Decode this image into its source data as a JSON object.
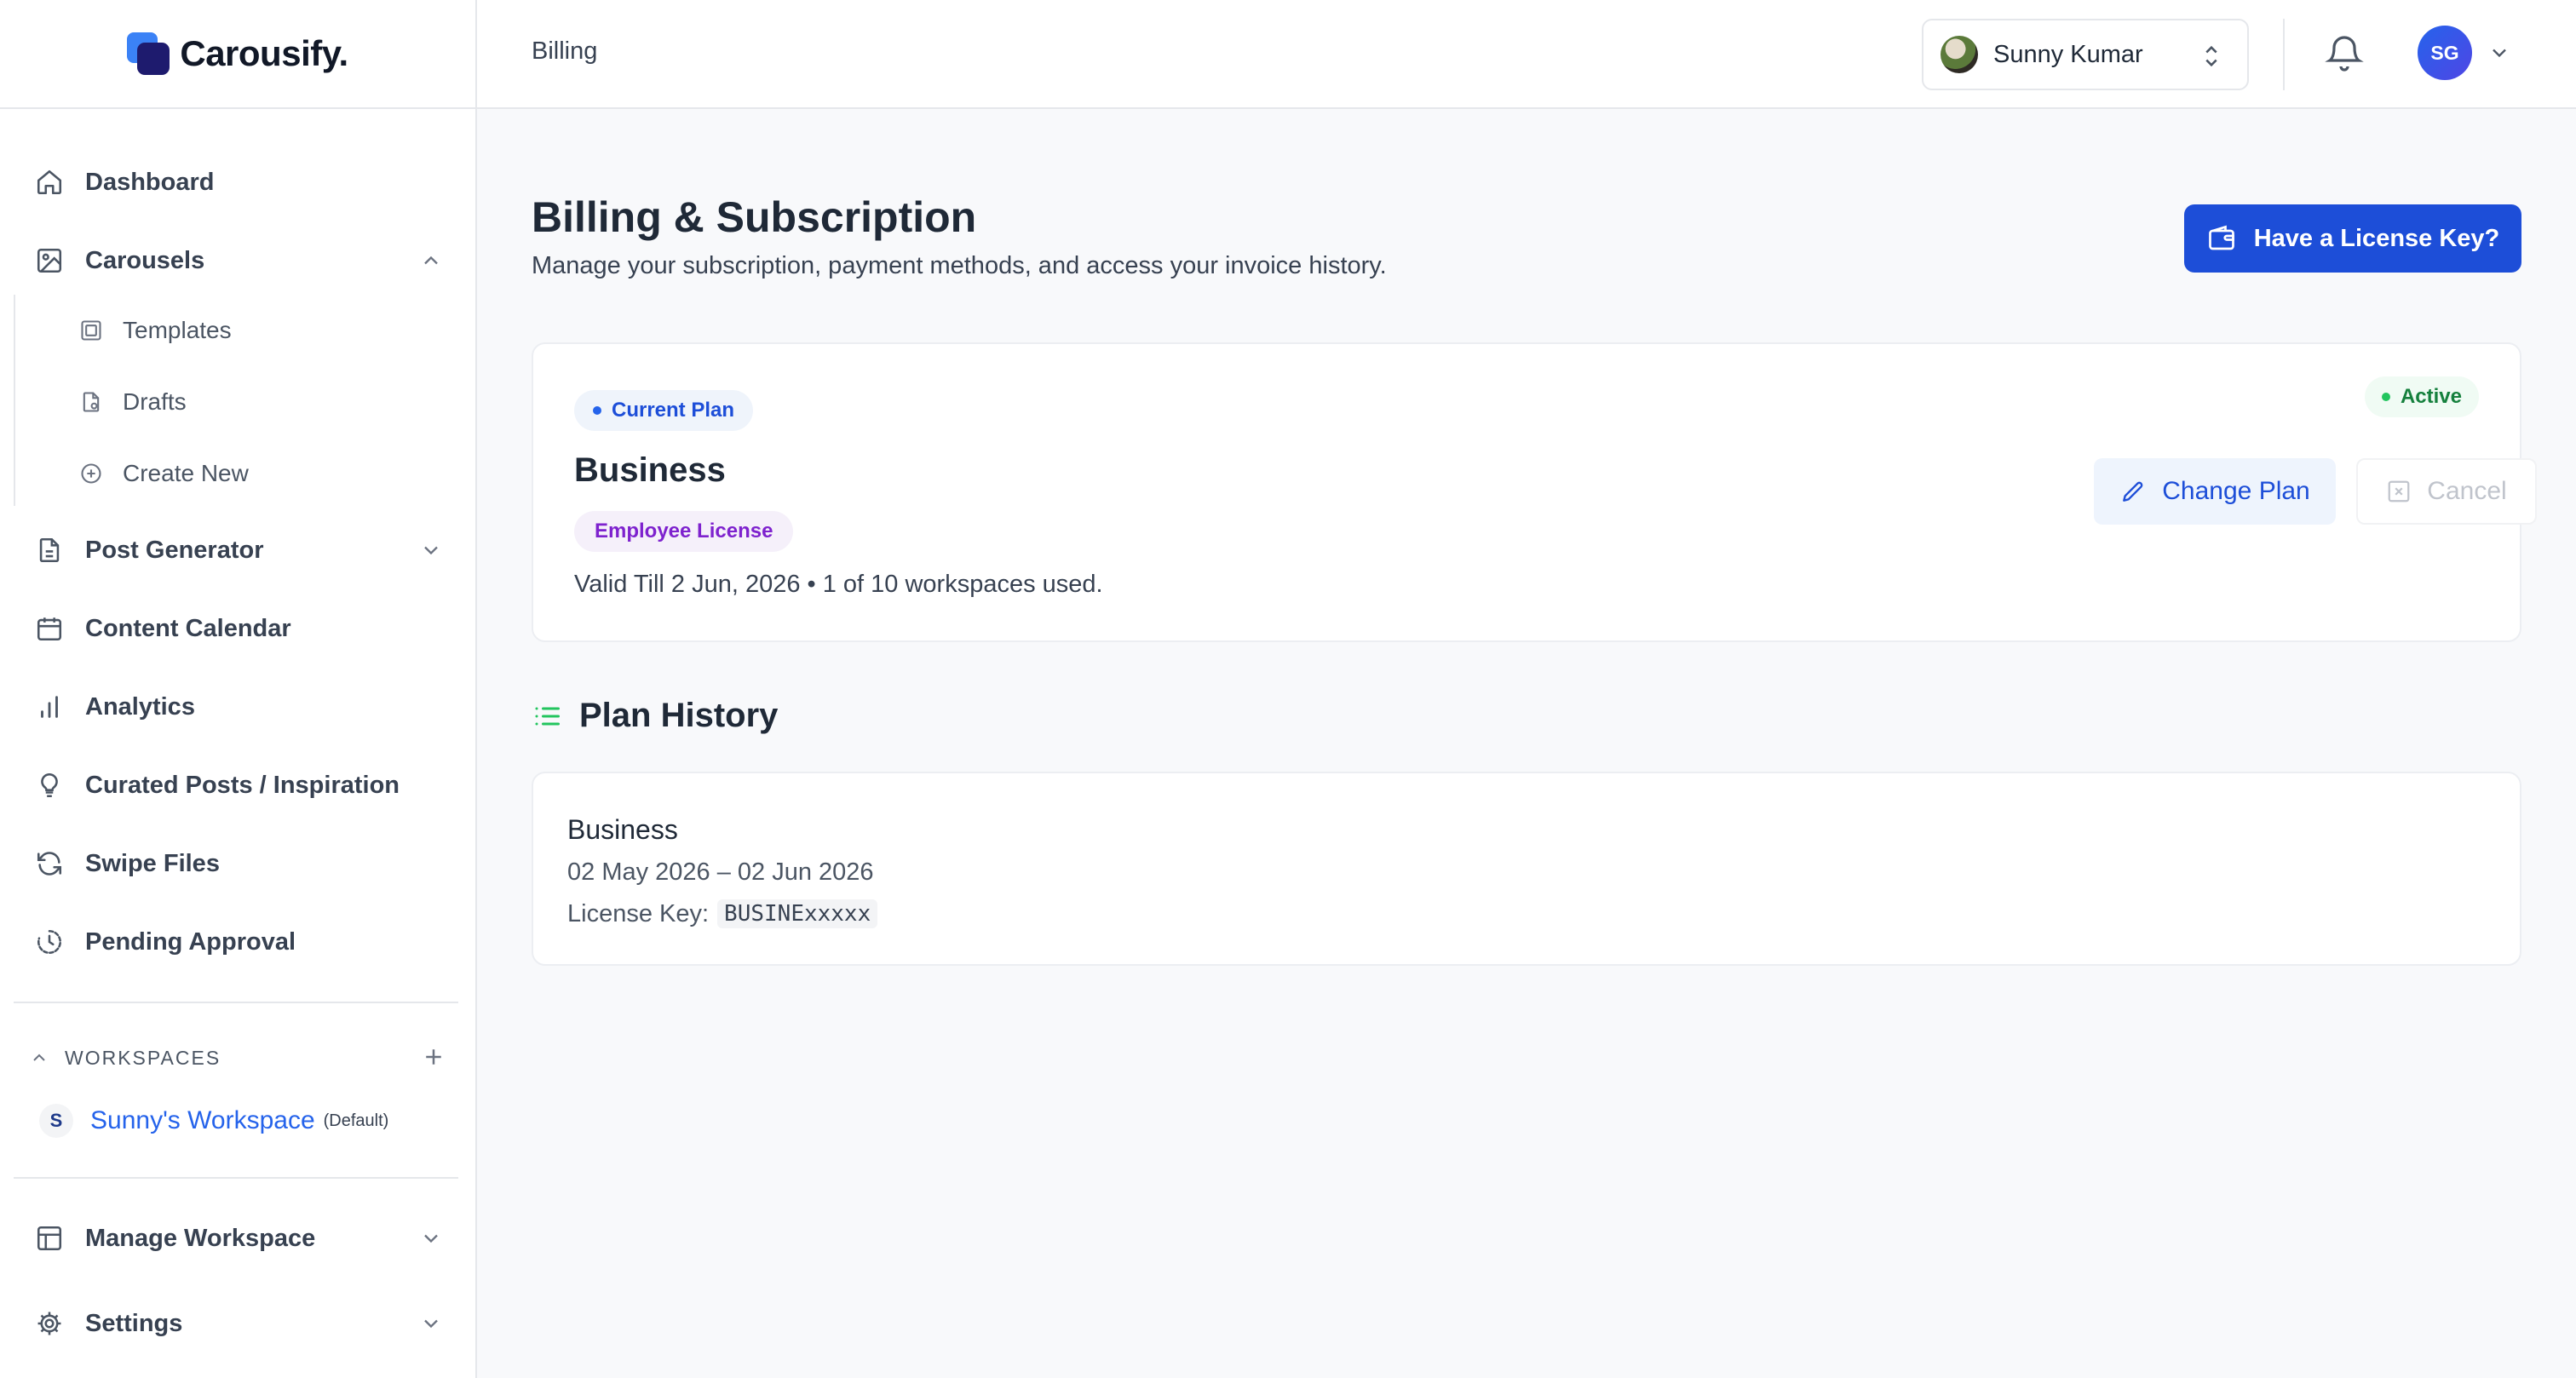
{
  "brand": {
    "name": "Carousify."
  },
  "sidebar": {
    "items": [
      {
        "label": "Dashboard",
        "icon": "home-icon"
      },
      {
        "label": "Carousels",
        "icon": "image-icon",
        "expanded": true
      },
      {
        "label": "Post Generator",
        "icon": "document-icon"
      },
      {
        "label": "Content Calendar",
        "icon": "calendar-icon"
      },
      {
        "label": "Analytics",
        "icon": "bar-chart-icon"
      },
      {
        "label": "Curated Posts / Inspiration",
        "icon": "lightbulb-icon"
      },
      {
        "label": "Swipe Files",
        "icon": "refresh-icon"
      },
      {
        "label": "Pending Approval",
        "icon": "clock-dashed-icon"
      }
    ],
    "carousels_sub": [
      {
        "label": "Templates",
        "icon": "template-icon"
      },
      {
        "label": "Drafts",
        "icon": "draft-file-icon"
      },
      {
        "label": "Create New",
        "icon": "plus-circle-icon"
      }
    ],
    "workspaces": {
      "heading": "WORKSPACES",
      "items": [
        {
          "initial": "S",
          "name": "Sunny's Workspace",
          "tag": "(Default)"
        }
      ]
    },
    "bottom": [
      {
        "label": "Manage Workspace",
        "icon": "layout-icon"
      },
      {
        "label": "Settings",
        "icon": "gear-icon"
      }
    ]
  },
  "topbar": {
    "breadcrumb": "Billing",
    "user": {
      "name": "Sunny Kumar"
    },
    "profile_initials": "SG"
  },
  "page": {
    "title": "Billing & Subscription",
    "subtitle": "Manage your subscription, payment methods, and access your invoice history.",
    "license_button": "Have a License Key?"
  },
  "current_plan": {
    "badge": "Current Plan",
    "name": "Business",
    "license_type": "Employee License",
    "meta": "Valid Till 2 Jun, 2026 • 1 of 10 workspaces used.",
    "status": "Active",
    "change_label": "Change Plan",
    "cancel_label": "Cancel"
  },
  "history": {
    "title": "Plan History",
    "entries": [
      {
        "name": "Business",
        "dates": "02 May 2026 – 02 Jun 2026",
        "key_label": "License Key:",
        "key_value": "BUSINExxxxx"
      }
    ]
  },
  "colors": {
    "accent": "#1d4ed8",
    "active": "#22c55e",
    "license": "#7e22ce"
  }
}
